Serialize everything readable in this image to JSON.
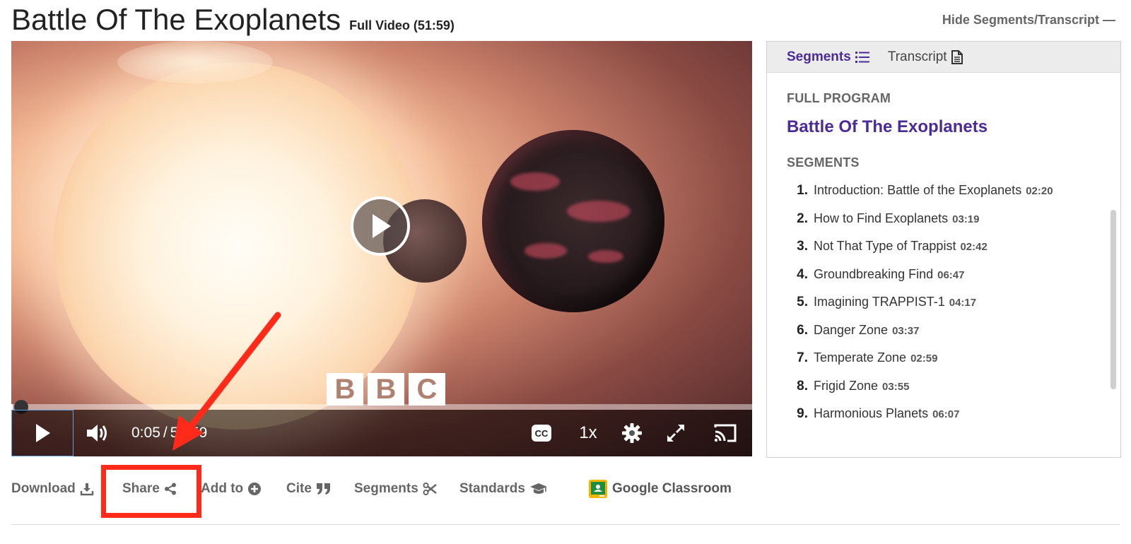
{
  "header": {
    "title": "Battle Of The Exoplanets",
    "full_video": "Full Video (51:59)",
    "hide_toggle": "Hide Segments/Transcript —"
  },
  "video": {
    "logo_letters": [
      "B",
      "B",
      "C"
    ],
    "current_time": "0:05",
    "duration": "51:59",
    "progress_percent": 0.2,
    "speed": "1x",
    "cc_label": "CC"
  },
  "toolbar": {
    "download": "Download",
    "share": "Share",
    "add_to": "Add to",
    "cite": "Cite",
    "segments": "Segments",
    "standards": "Standards",
    "google_classroom": "Google Classroom"
  },
  "panel": {
    "tabs": {
      "segments": "Segments",
      "transcript": "Transcript"
    },
    "full_program_label": "FULL PROGRAM",
    "program_title": "Battle Of The Exoplanets",
    "segments_label": "SEGMENTS",
    "segments": [
      {
        "num": "1.",
        "title": "Introduction: Battle of the Exoplanets",
        "duration": "02:20"
      },
      {
        "num": "2.",
        "title": "How to Find Exoplanets",
        "duration": "03:19"
      },
      {
        "num": "3.",
        "title": "Not That Type of Trappist",
        "duration": "02:42"
      },
      {
        "num": "4.",
        "title": "Groundbreaking Find",
        "duration": "06:47"
      },
      {
        "num": "5.",
        "title": "Imagining TRAPPIST-1",
        "duration": "04:17"
      },
      {
        "num": "6.",
        "title": "Danger Zone",
        "duration": "03:37"
      },
      {
        "num": "7.",
        "title": "Temperate Zone",
        "duration": "02:59"
      },
      {
        "num": "8.",
        "title": "Frigid Zone",
        "duration": "03:55"
      },
      {
        "num": "9.",
        "title": "Harmonious Planets",
        "duration": "06:07"
      }
    ]
  },
  "colors": {
    "accent": "#4b2a9a",
    "highlight": "#ff2a1a",
    "toolbar_text": "#666666"
  }
}
